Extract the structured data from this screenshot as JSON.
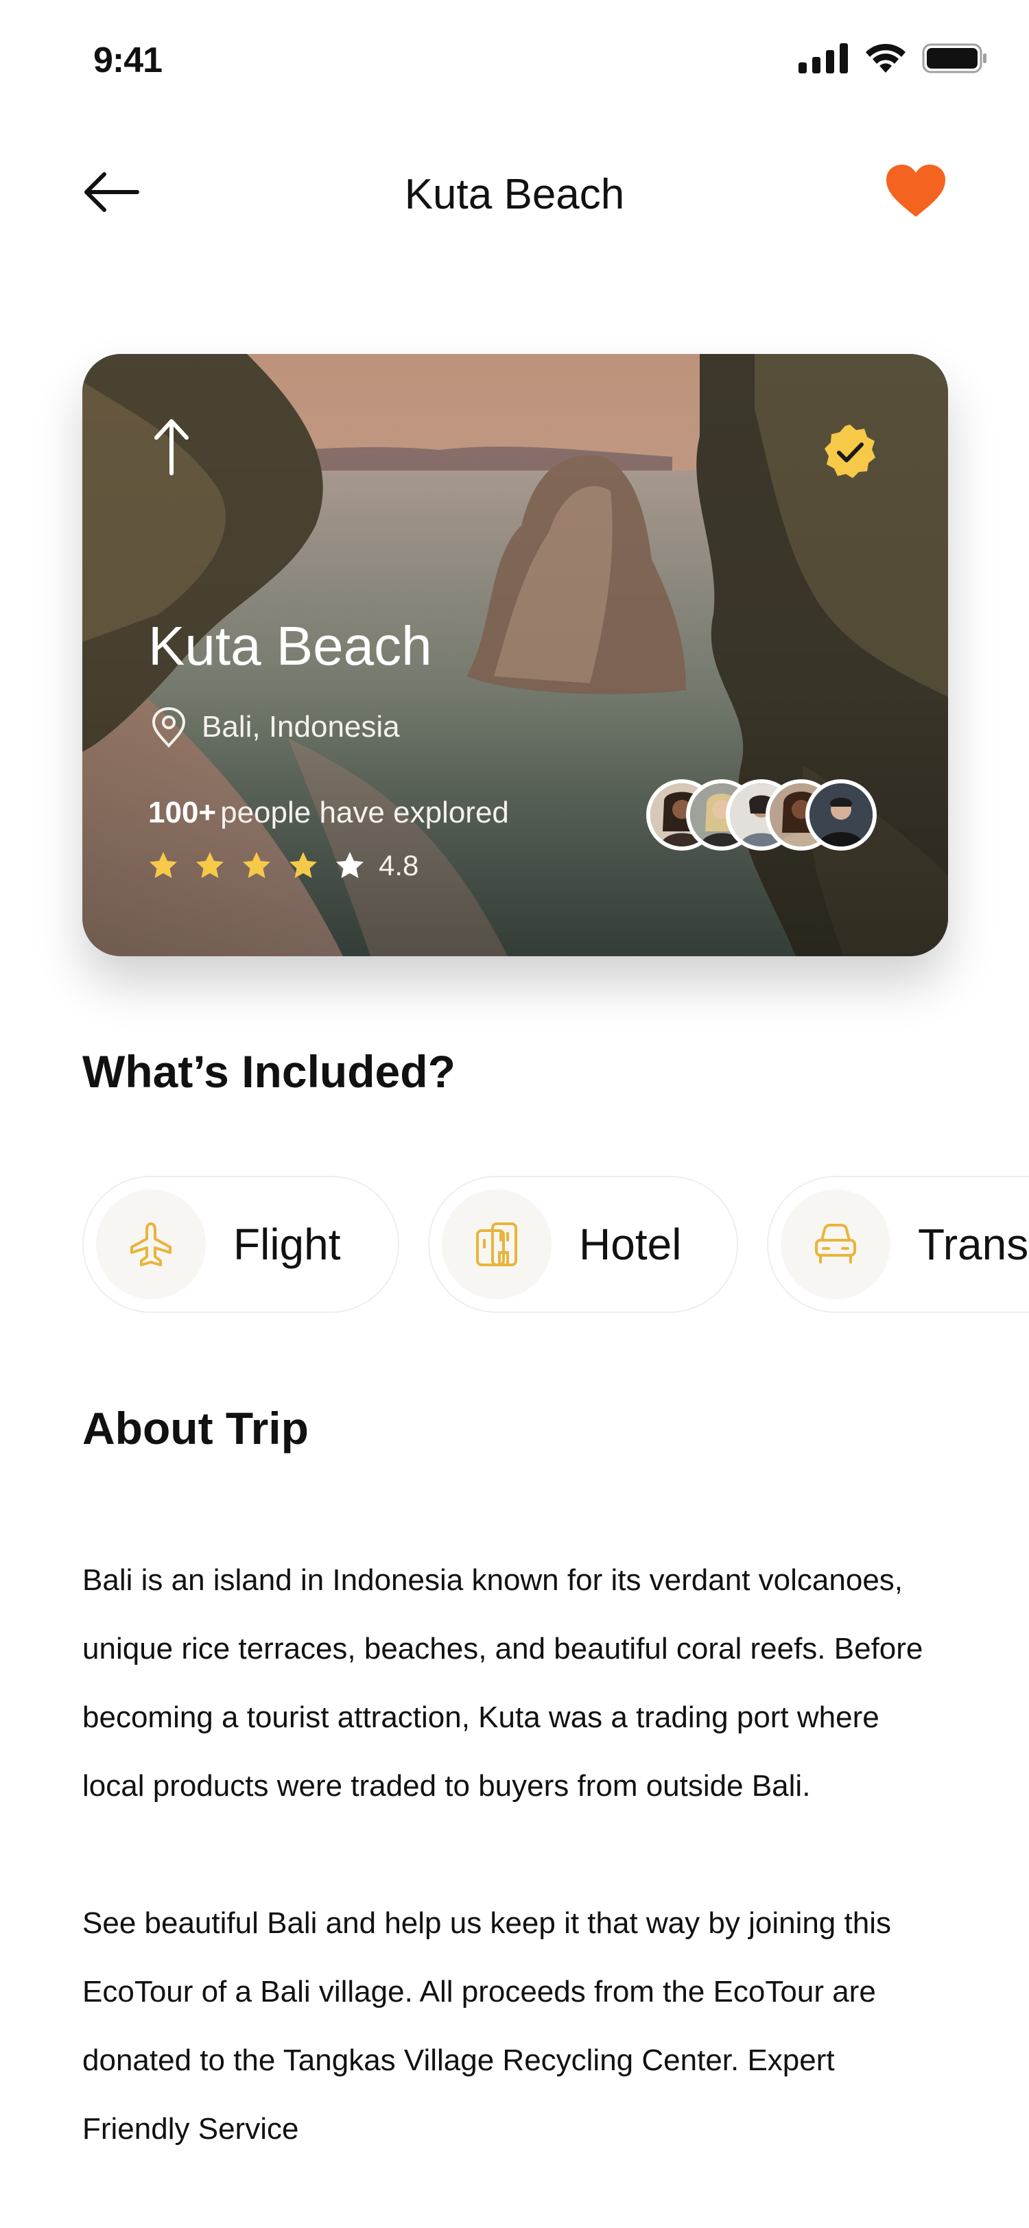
{
  "status_bar": {
    "time": "9:41",
    "icons": [
      "signal-icon",
      "wifi-icon",
      "battery-icon"
    ]
  },
  "header": {
    "title": "Kuta Beach",
    "back_icon": "arrow-left-icon",
    "favorite_icon": "heart-icon",
    "favorite_color": "#F4631F"
  },
  "hero": {
    "title": "Kuta Beach",
    "location": "Bali, Indonesia",
    "explored_count": "100+",
    "explored_text": "people have explored",
    "stars": 5,
    "filled_stars": 4,
    "rating": "4.8",
    "star_color": "#F7C948",
    "verified_badge_color": "#F7C948",
    "visitor_avatars": 5
  },
  "included": {
    "title": "What’s Included?",
    "items": [
      {
        "label": "Flight",
        "icon": "airplane-icon"
      },
      {
        "label": "Hotel",
        "icon": "hotel-icon"
      },
      {
        "label": "Transport",
        "icon": "car-icon"
      }
    ],
    "icon_color": "#E8B53A"
  },
  "about": {
    "title": "About Trip",
    "paragraphs": [
      "Bali is an island in Indonesia known for its verdant volcanoes, unique rice terraces, beaches, and beautiful coral reefs. Before becoming a tourist attraction, Kuta was a trading port where local products were traded to buyers from outside Bali.",
      "See beautiful Bali and help us keep it that way by joining this EcoTour of a Bali village. All proceeds from the EcoTour are donated to the Tangkas Village Recycling Center. Expert Friendly Service"
    ]
  }
}
